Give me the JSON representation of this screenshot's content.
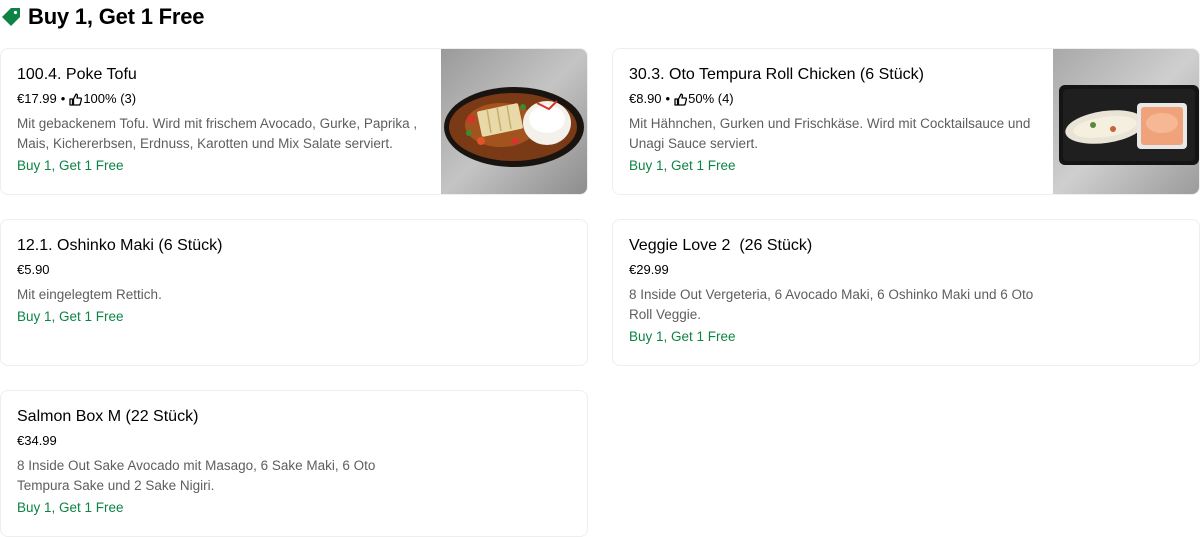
{
  "section": {
    "title": "Buy 1, Get 1 Free",
    "icon": "tag-icon",
    "accent": "#0e8345"
  },
  "items": [
    {
      "name": "100.4. Poke Tofu",
      "price": "€17.99",
      "separator": "•",
      "rating": "100% (3)",
      "description": "Mit gebackenem Tofu. Wird mit frischem Avocado, Gurke, Paprika , Mais, Kichererbsen, Erdnuss, Karotten und Mix Salate serviert.",
      "promo": "Buy 1, Get 1 Free",
      "image": "poke-tofu-dish"
    },
    {
      "name": "30.3. Oto Tempura Roll Chicken (6 Stück)",
      "price": "€8.90",
      "separator": "•",
      "rating": "50% (4)",
      "description": "Mit Hähnchen, Gurken und Frischkäse. Wird mit Cocktailsauce und Unagi Sauce serviert.",
      "promo": "Buy 1, Get 1 Free",
      "image": "tempura-roll-dish"
    },
    {
      "name": "12.1. Oshinko Maki (6 Stück)",
      "price": "€5.90",
      "description": "Mit eingelegtem Rettich.",
      "promo": "Buy 1, Get 1 Free"
    },
    {
      "name": "Veggie Love 2  (26 Stück)",
      "price": "€29.99",
      "description": "8 Inside Out Vergeteria, 6 Avocado Maki, 6 Oshinko Maki und 6 Oto Roll Veggie.",
      "promo": "Buy 1, Get 1 Free"
    },
    {
      "name": "Salmon Box M (22 Stück)",
      "price": "€34.99",
      "description": "8 Inside Out Sake Avocado mit Masago, 6 Sake Maki, 6 Oto Tempura Sake und 2 Sake Nigiri.",
      "promo": "Buy 1, Get 1 Free"
    }
  ]
}
